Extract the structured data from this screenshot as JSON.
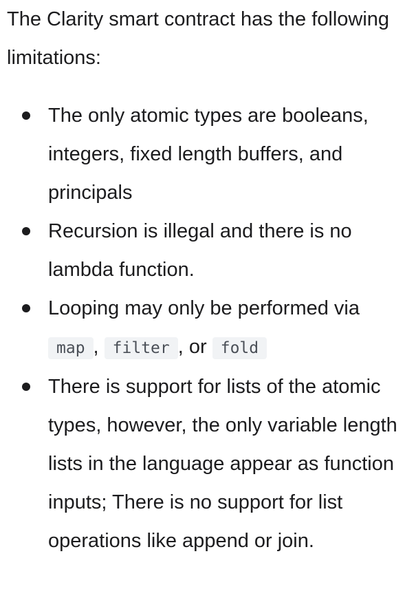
{
  "intro": "The Clarity smart contract has the following limitations:",
  "bullets": [
    {
      "text": "The only atomic types are booleans, integers, fixed length buffers, and principals"
    },
    {
      "text": "Recursion is illegal and there is no lambda function."
    },
    {
      "prefix": "Looping may only be performed via",
      "code_1": "map",
      "sep_1": ",",
      "code_2": "filter",
      "sep_2": ", or",
      "code_3": "fold"
    },
    {
      "text": "There is support for lists of the atomic types, however, the only variable length lists in the language appear as function inputs; There is no support for list operations like append or join."
    }
  ]
}
